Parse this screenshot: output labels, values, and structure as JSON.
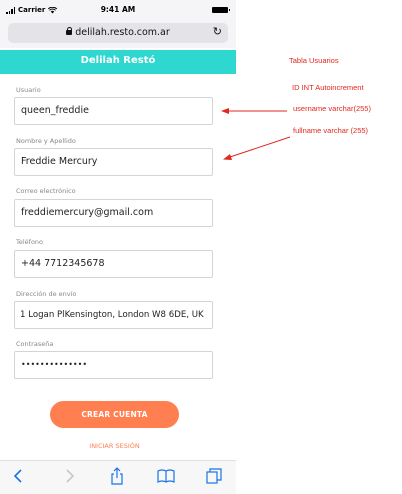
{
  "status_bar": {
    "carrier": "Carrier",
    "time": "9:41 AM"
  },
  "browser": {
    "url": "delilah.resto.com.ar"
  },
  "app": {
    "title": "Delilah Restó"
  },
  "form": {
    "fields": [
      {
        "label": "Usuario",
        "value": "queen_freddie"
      },
      {
        "label": "Nombre y Apellido",
        "value": "Freddie Mercury"
      },
      {
        "label": "Correo electrónico",
        "value": "freddiemercury@gmail.com"
      },
      {
        "label": "Teléfono",
        "value": "+44 7712345678"
      },
      {
        "label": "Dirección de envío",
        "value": "1 Logan PlKensington, London W8 6DE, UK"
      },
      {
        "label": "Contraseña",
        "value": "••••••••••••••"
      }
    ],
    "submit_label": "CREAR CUENTA",
    "login_link": "INICIAR SESIÓN"
  },
  "toolbar": {
    "icons": [
      "back-icon",
      "forward-icon",
      "share-icon",
      "bookmarks-icon",
      "tabs-icon"
    ]
  },
  "annotations": {
    "table_title": "Tabla Usuarios",
    "id_note": "ID INT Autoincrement",
    "username_note": "username varchar(255)",
    "fullname_note": "fullname varchar (255)",
    "color": "#e0281f"
  },
  "colors": {
    "header": "#2ed8d0",
    "accent": "#ff7f50"
  }
}
